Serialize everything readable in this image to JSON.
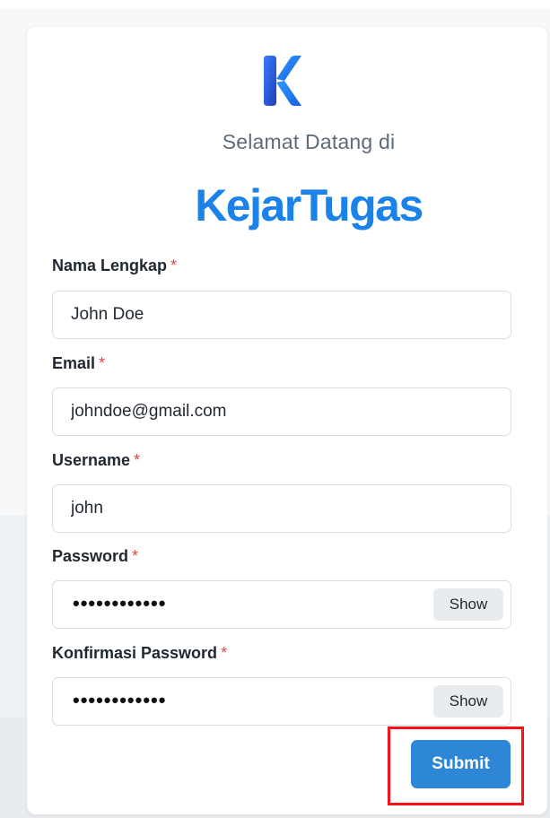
{
  "header": {
    "welcome_text": "Selamat Datang di",
    "brand_name": "KejarTugas"
  },
  "colors": {
    "brand": "#1b82ea",
    "required": "#e04848",
    "submit_bg": "#2d87d6",
    "highlight": "#ff0f1a"
  },
  "form": {
    "required_mark": "*",
    "full_name": {
      "label": "Nama Lengkap",
      "value": "John Doe"
    },
    "email": {
      "label": "Email",
      "value": "johndoe@gmail.com"
    },
    "username": {
      "label": "Username",
      "value": "john"
    },
    "password": {
      "label": "Password",
      "masked_value": "••••••••••••",
      "show_label": "Show"
    },
    "confirm_password": {
      "label": "Konfirmasi Password",
      "masked_value": "••••••••••••",
      "show_label": "Show"
    },
    "submit_label": "Submit"
  },
  "icons": {
    "logo": "k-logo-icon"
  }
}
